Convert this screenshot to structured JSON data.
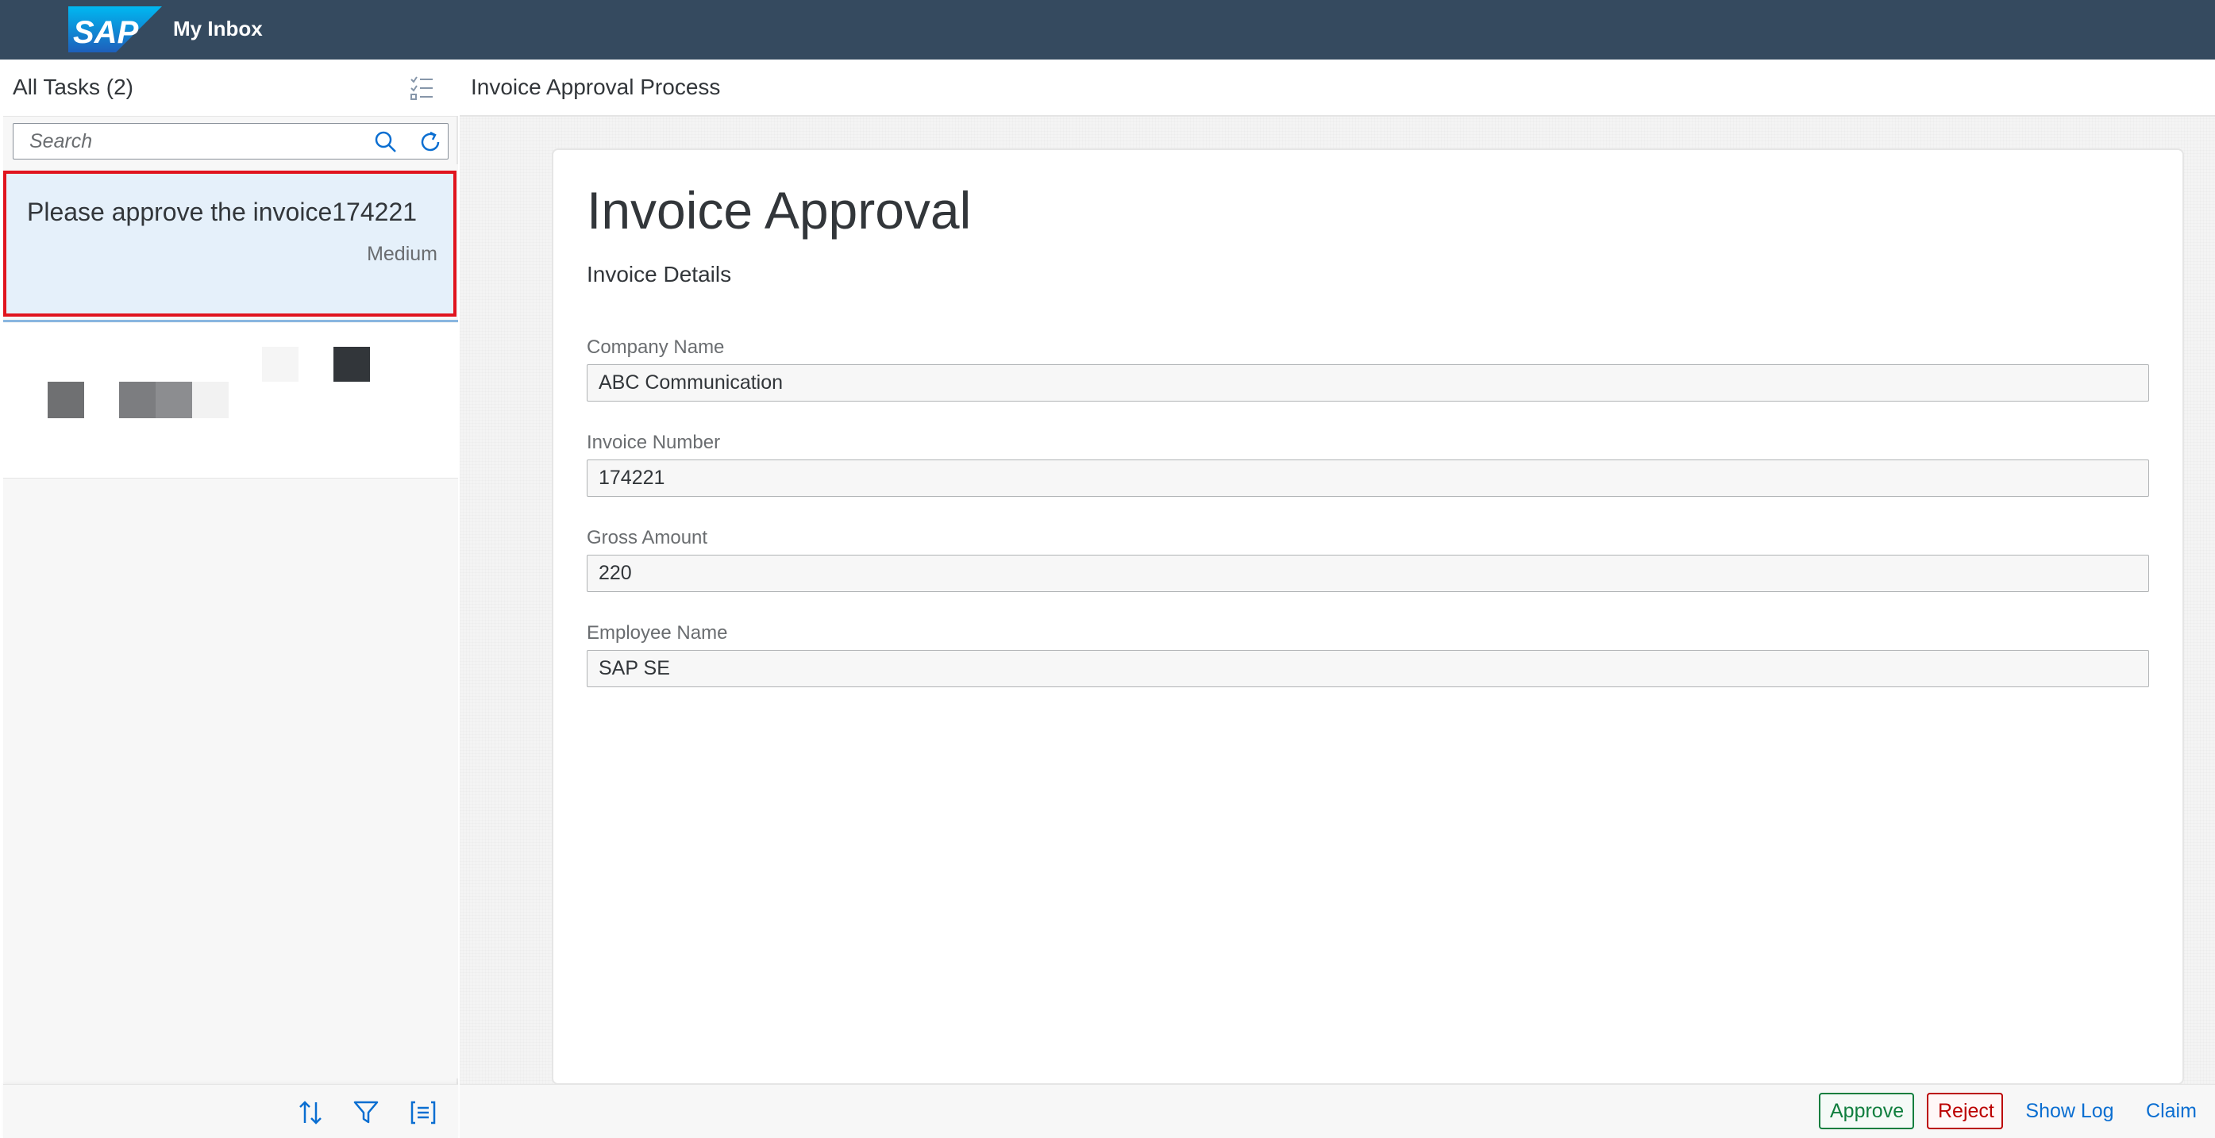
{
  "shell": {
    "logo_text": "SAP",
    "app_title": "My Inbox"
  },
  "master": {
    "title": "All Tasks (2)",
    "search": {
      "placeholder": "Search",
      "value": ""
    },
    "tasks": [
      {
        "title": "Please approve the invoice174221",
        "priority": "Medium"
      }
    ]
  },
  "detail": {
    "header_title": "Invoice Approval Process",
    "form": {
      "title": "Invoice Approval",
      "subtitle": "Invoice Details",
      "fields": [
        {
          "label": "Company Name",
          "value": "ABC Communication"
        },
        {
          "label": "Invoice Number",
          "value": "174221"
        },
        {
          "label": "Gross Amount",
          "value": "220"
        },
        {
          "label": "Employee Name",
          "value": "SAP SE"
        }
      ]
    },
    "actions": {
      "approve": "Approve",
      "reject": "Reject",
      "show_log": "Show Log",
      "claim": "Claim"
    }
  },
  "colors": {
    "shell_bg": "#354a5f",
    "brand_blue": "#0a6ed1",
    "selection_bg": "#e5f0fa",
    "highlight_border": "#e0141e",
    "positive": "#107e3e",
    "negative": "#bb0000"
  },
  "icons": {
    "multi_select": "multi-select-icon",
    "search": "search-icon",
    "refresh": "refresh-icon",
    "sort": "sort-icon",
    "filter": "filter-icon",
    "group": "group-icon"
  }
}
